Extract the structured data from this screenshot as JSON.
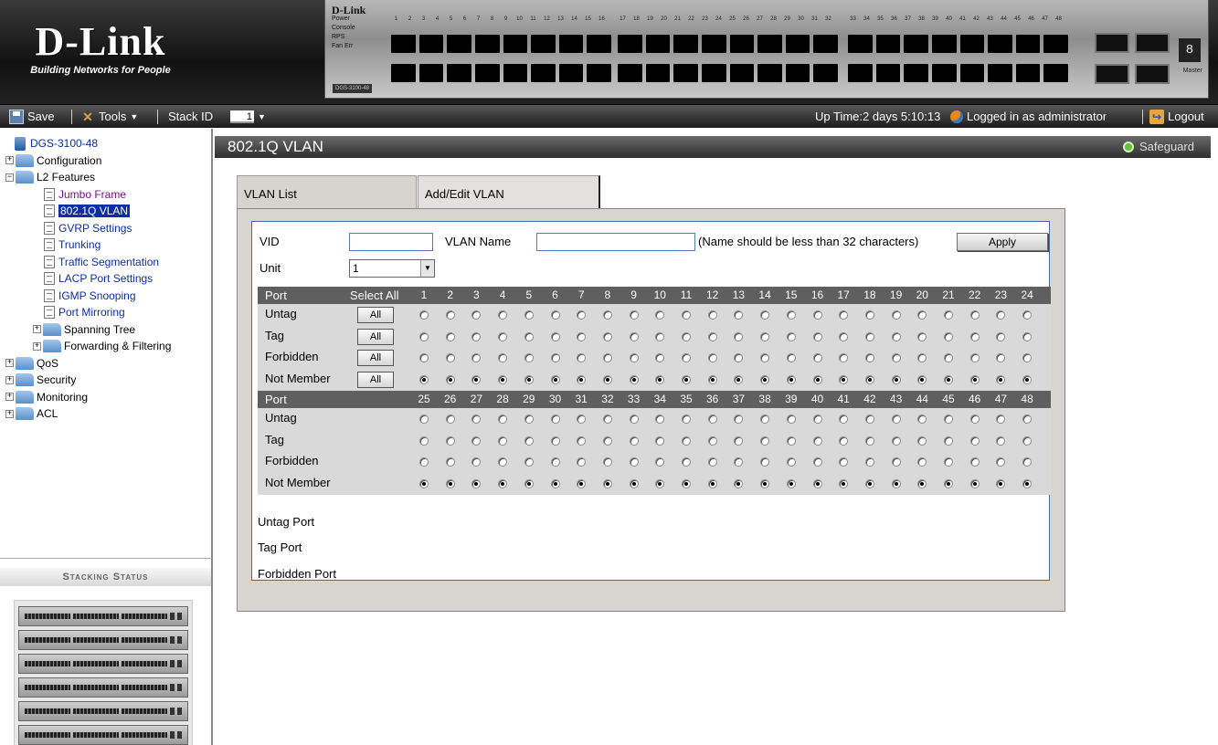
{
  "brand": {
    "name": "D-Link",
    "tagline": "Building Networks for People"
  },
  "device": {
    "logo": "D-Link",
    "panel_labels": [
      "Power",
      "Console",
      "RPS",
      "Fan Err"
    ],
    "model": "DGS-3100-48",
    "port_numbers_top": [
      "1",
      "2",
      "3",
      "4",
      "5",
      "6",
      "7",
      "8",
      "9",
      "10",
      "11",
      "12",
      "13",
      "14",
      "15",
      "16",
      "17",
      "18",
      "19",
      "20",
      "21",
      "22",
      "23",
      "24",
      "25",
      "26",
      "27",
      "28",
      "29",
      "30",
      "31",
      "32",
      "33",
      "34",
      "35",
      "36",
      "37",
      "38",
      "39",
      "40",
      "41",
      "42",
      "43",
      "44",
      "45",
      "46",
      "47",
      "48"
    ],
    "digit": "8",
    "master_label": "Master"
  },
  "toolbar": {
    "save_label": "Save",
    "tools_label": "Tools",
    "stack_label": "Stack ID",
    "stack_value": "1",
    "uptime": "Up Time:2 days 5:10:13",
    "logged_in": "Logged in as administrator",
    "logout_label": "Logout"
  },
  "tree": {
    "root": "DGS-3100-48",
    "configuration": "Configuration",
    "l2_features": "L2 Features",
    "l2_children": [
      "Jumbo Frame",
      "802.1Q VLAN",
      "GVRP Settings",
      "Trunking",
      "Traffic Segmentation",
      "LACP Port Settings",
      "IGMP Snooping",
      "Port Mirroring"
    ],
    "spanning_tree": "Spanning Tree",
    "forwarding": "Forwarding & Filtering",
    "qos": "QoS",
    "security": "Security",
    "monitoring": "Monitoring",
    "acl": "ACL"
  },
  "stacking": {
    "title": "Stacking Status",
    "unit_count": 6
  },
  "main": {
    "title": "802.1Q VLAN",
    "safeguard": "Safeguard",
    "tabs": [
      "VLAN List",
      "Add/Edit VLAN"
    ],
    "form": {
      "vid_label": "VID",
      "vid_value": "",
      "vlan_name_label": "VLAN Name",
      "vlan_name_value": "",
      "name_hint": "(Name should be less than 32 characters)",
      "apply_label": "Apply",
      "unit_label": "Unit",
      "unit_value": "1"
    },
    "grid": {
      "port_header": "Port",
      "select_all": "Select All",
      "all_label": "All",
      "row_labels": [
        "Untag",
        "Tag",
        "Forbidden",
        "Not Member"
      ],
      "ports_block1": [
        "1",
        "2",
        "3",
        "4",
        "5",
        "6",
        "7",
        "8",
        "9",
        "10",
        "11",
        "12",
        "13",
        "14",
        "15",
        "16",
        "17",
        "18",
        "19",
        "20",
        "21",
        "22",
        "23",
        "24"
      ],
      "ports_block2": [
        "25",
        "26",
        "27",
        "28",
        "29",
        "30",
        "31",
        "32",
        "33",
        "34",
        "35",
        "36",
        "37",
        "38",
        "39",
        "40",
        "41",
        "42",
        "43",
        "44",
        "45",
        "46",
        "47",
        "48"
      ],
      "selected_row": "Not Member"
    },
    "bottom_labels": [
      "Untag Port",
      "Tag Port",
      "Forbidden Port"
    ]
  }
}
